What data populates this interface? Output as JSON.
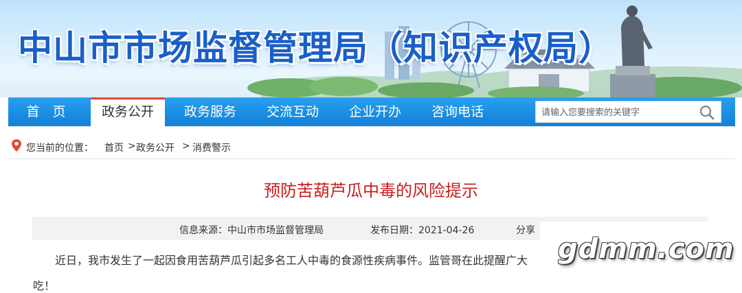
{
  "banner": {
    "title": "中山市市场监督管理局（知识产权局）"
  },
  "nav": {
    "items": [
      {
        "label": "首　页",
        "active": false
      },
      {
        "label": "政务公开",
        "active": true
      },
      {
        "label": "政务服务",
        "active": false
      },
      {
        "label": "交流互动",
        "active": false
      },
      {
        "label": "企业开办",
        "active": false
      },
      {
        "label": "咨询电话",
        "active": false
      }
    ],
    "search_placeholder": "请输入您要搜索的关键字"
  },
  "breadcrumb": {
    "label": "您当前的位置：",
    "home": "首页",
    "sep1": ">",
    "section": "政务公开",
    "sep2": ">",
    "current": "消费警示"
  },
  "article": {
    "title": "预防苦葫芦瓜中毒的风险提示",
    "meta": {
      "source": "信息来源：中山市市场监督管理局",
      "date": "发布日期：2021-04-26",
      "share": "分享"
    },
    "paragraph_line1": "近日，我市发生了一起因食用苦葫芦瓜引起多名工人中毒的食源性疾病事件。监管哥在此提醒广大",
    "paragraph_line2": "吃！"
  },
  "watermark": "gdmm.com",
  "colors": {
    "nav_blue": "#1a8ee3",
    "active_underline": "#e3462d",
    "title_red": "#c81d1d",
    "banner_title_blue": "#1a5fc8"
  }
}
